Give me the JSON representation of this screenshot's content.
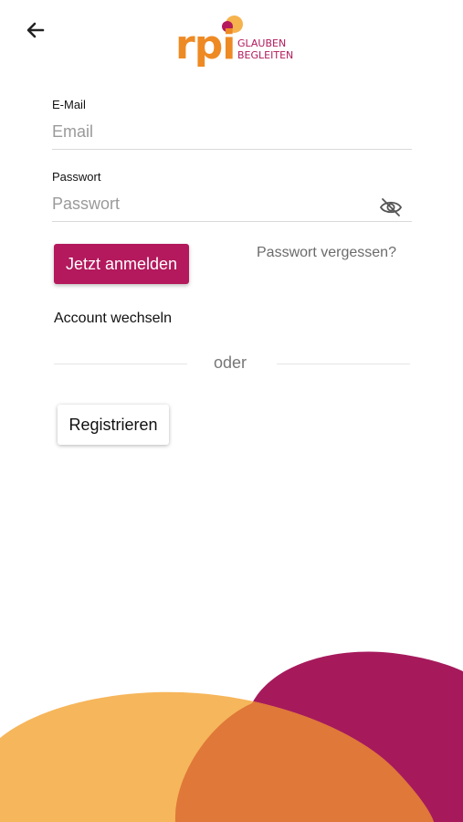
{
  "header": {
    "back_icon": "arrow-left-icon",
    "logo": {
      "brand": "rpi",
      "tagline_line1": "GLAUBEN",
      "tagline_line2": "BEGLEITEN"
    }
  },
  "form": {
    "email": {
      "label": "E-Mail",
      "placeholder": "Email",
      "value": ""
    },
    "password": {
      "label": "Passwort",
      "placeholder": "Passwort",
      "value": "",
      "toggle_icon": "eye-off-icon"
    },
    "login_button": "Jetzt anmelden",
    "forgot_password": "Passwort vergessen?",
    "switch_account": "Account wechseln",
    "divider_text": "oder",
    "register_button": "Registrieren"
  },
  "colors": {
    "primary": "#b3195c",
    "brand_orange": "#ee8a24",
    "blob_yellow": "#f6b65b",
    "blob_magenta": "#a61a5c",
    "blob_overlap": "#df7838"
  }
}
